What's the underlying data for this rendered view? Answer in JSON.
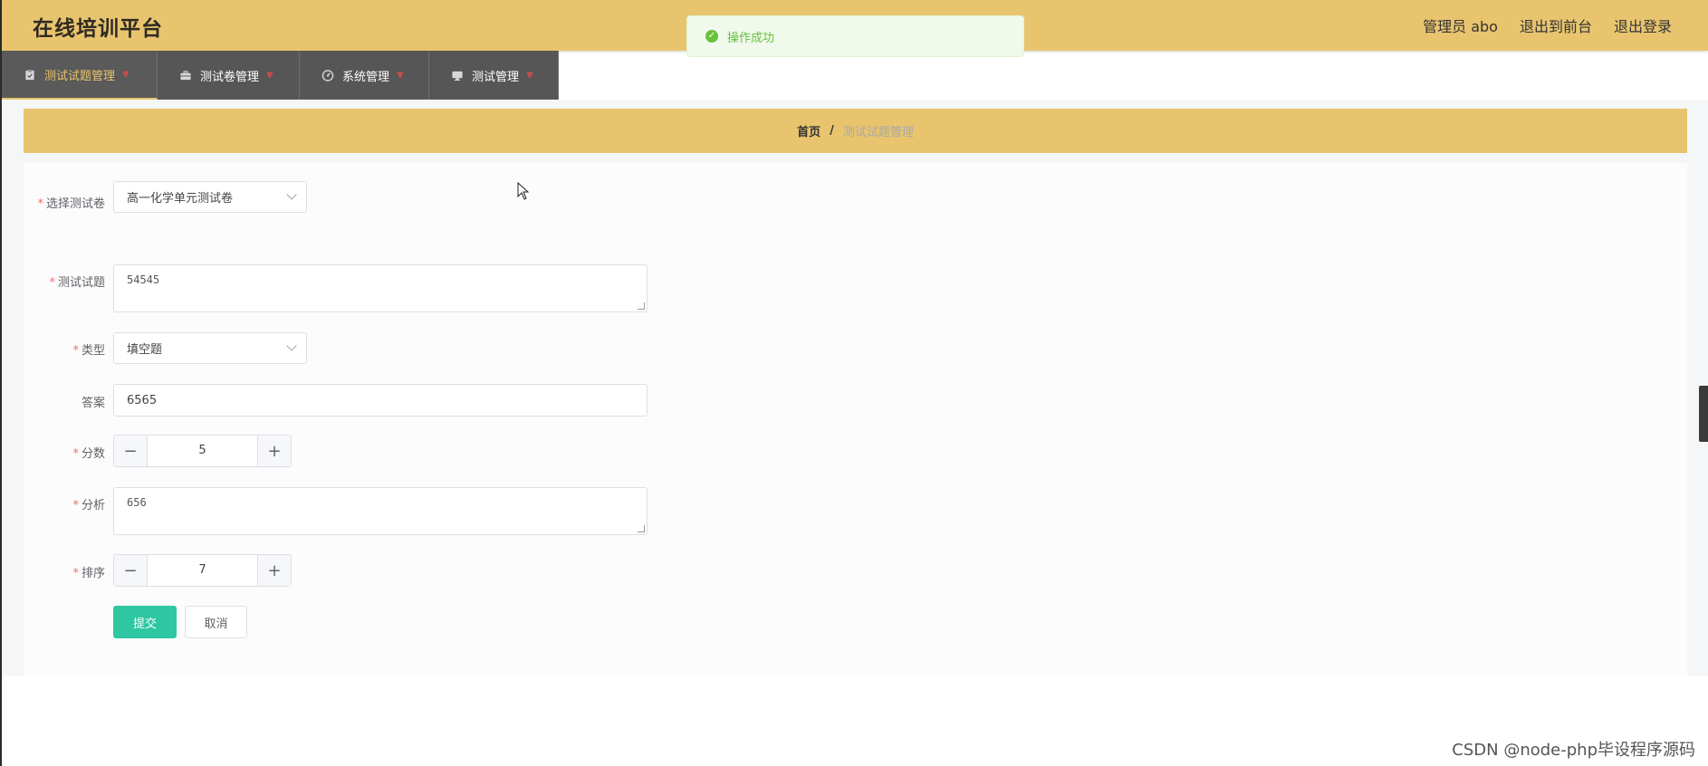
{
  "header": {
    "title": "在线培训平台",
    "links": [
      "管理员 abo",
      "退出到前台",
      "退出登录"
    ]
  },
  "toast": {
    "message": "操作成功",
    "icon": "success-check-icon"
  },
  "nav": {
    "items": [
      {
        "label": "测试试题管理",
        "icon": "clipboard-icon",
        "active": true
      },
      {
        "label": "测试卷管理",
        "icon": "briefcase-icon",
        "active": false
      },
      {
        "label": "系统管理",
        "icon": "gauge-icon",
        "active": false
      },
      {
        "label": "测试管理",
        "icon": "monitor-icon",
        "active": false
      }
    ]
  },
  "breadcrumb": {
    "home": "首页",
    "separator": "/",
    "current": "测试试题管理"
  },
  "form": {
    "paper": {
      "label": "选择测试卷",
      "value": "高一化学单元测试卷",
      "required": true
    },
    "question": {
      "label": "测试试题",
      "value": "54545",
      "required": true
    },
    "type": {
      "label": "类型",
      "value": "填空题",
      "required": true
    },
    "answer": {
      "label": "答案",
      "value": "6565",
      "required": false
    },
    "score": {
      "label": "分数",
      "value": "5",
      "required": true
    },
    "analysis": {
      "label": "分析",
      "value": "656",
      "required": true
    },
    "order": {
      "label": "排序",
      "value": "7",
      "required": true
    },
    "submit_label": "提交",
    "cancel_label": "取消",
    "required_mark": "*",
    "minus": "−",
    "plus": "+"
  },
  "watermark": "CSDN @node-php毕设程序源码",
  "colors": {
    "accent": "#e8c46e",
    "primary": "#2ec7a2",
    "nav": "#565656",
    "success": "#67c23a",
    "required": "#f56c6c"
  }
}
